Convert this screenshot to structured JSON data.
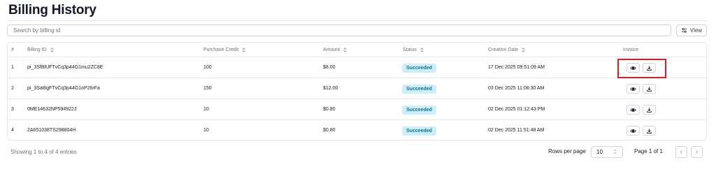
{
  "page": {
    "title": "Billing History"
  },
  "search": {
    "placeholder": "Search by billing id"
  },
  "toolbar": {
    "view_label": "View"
  },
  "table": {
    "columns": [
      "#",
      "Billing ID",
      "Purchase Credit",
      "Amount",
      "Status",
      "Creation Date",
      "Invoice"
    ],
    "rows": [
      {
        "num": "1",
        "billing_id": "pi_3SfBlUFTvCq3p44G1mu2ZC8E",
        "credit": "100",
        "amount": "$8.00",
        "status": "Succeeded",
        "date": "17 Dec 2025 09:51:09 AM"
      },
      {
        "num": "2",
        "billing_id": "pi_3Sa8lgFTvCq3p44G1oP26rFa",
        "credit": "150",
        "amount": "$12.00",
        "status": "Succeeded",
        "date": "03 Dec 2025 11:08:30 AM"
      },
      {
        "num": "3",
        "billing_id": "0ME14632NP594922J",
        "credit": "10",
        "amount": "$0.80",
        "status": "Succeeded",
        "date": "02 Dec 2025 01:12:43 PM"
      },
      {
        "num": "4",
        "billing_id": "2A651038TS298804H",
        "credit": "10",
        "amount": "$0.80",
        "status": "Succeeded",
        "date": "02 Dec 2025 11:51:48 AM"
      }
    ]
  },
  "footer": {
    "showing": "Showing 1 to 4 of 4 entries",
    "rows_per_page_label": "Rows per page",
    "rows_per_page_value": "10",
    "page_info": "Page 1 of 1"
  },
  "icons": {
    "view_invoice": "eye-icon",
    "download_invoice": "download-icon",
    "prev": "chevron-left-icon",
    "next": "chevron-right-icon",
    "view_settings": "sliders-icon"
  },
  "colors": {
    "status_bg": "#cdeefa",
    "status_text": "#0e7490",
    "highlight": "#e11d24"
  }
}
